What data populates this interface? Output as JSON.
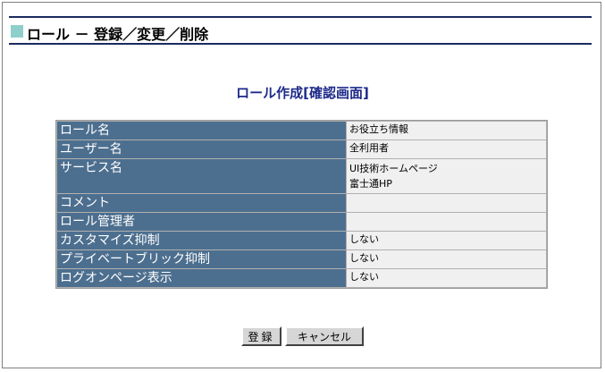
{
  "header": {
    "title": "ロール － 登録／変更／削除"
  },
  "main": {
    "heading": "ロール作成[確認画面]",
    "rows": [
      {
        "label": "ロール名",
        "values": [
          "お役立ち情報"
        ]
      },
      {
        "label": "ユーザー名",
        "values": [
          "全利用者"
        ]
      },
      {
        "label": "サービス名",
        "values": [
          "UI技術ホームページ",
          "富士通HP"
        ]
      },
      {
        "label": "コメント",
        "values": [
          ""
        ]
      },
      {
        "label": "ロール管理者",
        "values": [
          ""
        ]
      },
      {
        "label": "カスタマイズ抑制",
        "values": [
          "しない"
        ]
      },
      {
        "label": "プライベートブリック抑制",
        "values": [
          "しない"
        ]
      },
      {
        "label": "ログオンページ表示",
        "values": [
          "しない"
        ]
      }
    ]
  },
  "buttons": {
    "register": "登録",
    "cancel": "キャンセル"
  },
  "colors": {
    "label_bg": "#4d6f8f",
    "heading": "#1e2a8a",
    "title_square": "#8ecfca",
    "rule": "#1a2a5e"
  }
}
